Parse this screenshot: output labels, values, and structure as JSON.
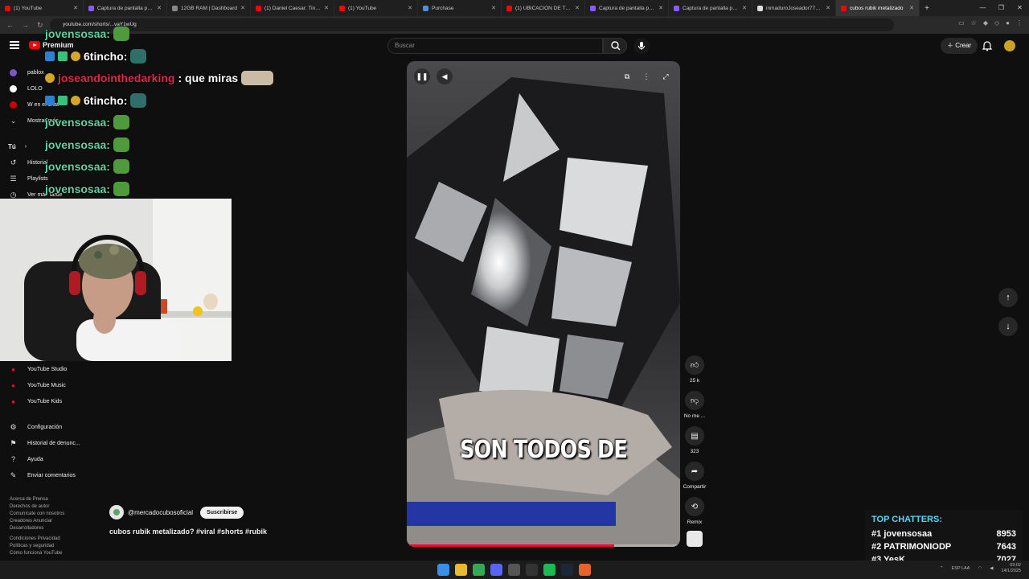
{
  "browser": {
    "tabs": [
      {
        "label": "(1) YouTube",
        "color": "#ff0000"
      },
      {
        "label": "Captura de pantalla por Lightshot",
        "color": "#8a5cf6"
      },
      {
        "label": "12GB RAM | Dashboard",
        "color": "#888888"
      },
      {
        "label": "(1) Daniel Caesar: Tiny Desk",
        "color": "#ff0000"
      },
      {
        "label": "(1) YouTube",
        "color": "#ff0000"
      },
      {
        "label": "Purchase",
        "color": "#4a90e2"
      },
      {
        "label": "(1) UBICACIÓN DE TODOS",
        "color": "#ff0000"
      },
      {
        "label": "Captura de pantalla por Lightshot",
        "color": "#8a5cf6"
      },
      {
        "label": "Captura de pantalla por Lightshot",
        "color": "#8a5cf6"
      },
      {
        "label": "inmaduroJoseador777 en X",
        "color": "#dddddd"
      },
      {
        "label": "cubos rubik metalizado",
        "color": "#ff0000"
      }
    ],
    "url": "youtube.com/shorts/...vaY1wUg"
  },
  "header": {
    "logo_text": "Premium",
    "search_placeholder": "Buscar",
    "create_label": "Crear"
  },
  "sidebar": {
    "top_items": [
      {
        "label": "pablox",
        "icon": "avatar-icon",
        "color": "#7a56c7"
      },
      {
        "label": "LOLO",
        "icon": "avatar-icon",
        "color": "#ffffff"
      },
      {
        "label": "W en el chat",
        "icon": "avatar-icon",
        "color": "#cc0000"
      },
      {
        "label": "Mostrar más",
        "icon": "chevron-down-icon"
      }
    ],
    "you_label": "Tú",
    "you_items": [
      {
        "label": "Historial",
        "icon": "history-icon"
      },
      {
        "label": "Playlists",
        "icon": "playlists-icon"
      },
      {
        "label": "Ver más tarde",
        "icon": "clock-icon"
      }
    ],
    "more_items": [
      {
        "label": "YouTube Studio"
      },
      {
        "label": "YouTube Music"
      },
      {
        "label": "YouTube Kids"
      }
    ],
    "settings_items": [
      {
        "label": "Configuración",
        "icon": "gear-icon"
      },
      {
        "label": "Historial de denunc...",
        "icon": "flag-icon"
      },
      {
        "label": "Ayuda",
        "icon": "help-icon"
      },
      {
        "label": "Enviar comentarios",
        "icon": "feedback-icon"
      }
    ],
    "footer": [
      "Acerca de  Prensa",
      "Derechos de autor",
      "Comunícate con nosotros",
      "Creadores  Anunciar",
      "Desarrolladores",
      "",
      "Condiciones  Privacidad",
      "Políticas y seguridad",
      "Cómo funciona YouTube"
    ]
  },
  "chat": [
    {
      "user": "jovensosaa:",
      "message": "",
      "color": "#5fd3a5"
    },
    {
      "user": "6tincho:",
      "message": "",
      "color": "#ffffff"
    },
    {
      "user": "joseandointhedarking",
      "message": ": que miras",
      "color": "#e0284d"
    },
    {
      "user": "6tincho:",
      "message": "",
      "color": "#ffffff"
    },
    {
      "user": "jovensosaa:",
      "message": "",
      "color": "#5fd3a5"
    },
    {
      "user": "jovensosaa:",
      "message": "",
      "color": "#5fd3a5"
    },
    {
      "user": "jovensosaa:",
      "message": "",
      "color": "#5fd3a5"
    },
    {
      "user": "jovensosaa:",
      "message": "",
      "color": "#5fd3a5"
    }
  ],
  "video": {
    "caption": "SON TODOS DE",
    "progress": 0.76,
    "channel": "@mercadocubosoficial",
    "subscribe_label": "Suscribirse",
    "title": "cubos rubik metalizado? #viral #shorts #rubik"
  },
  "actions": {
    "like_count": "25 k",
    "dislike_label": "No me ...",
    "comments_count": "323",
    "share_label": "Compartir",
    "remix_label": "Remix"
  },
  "top_chatters": {
    "title": "TOP CHATTERS:",
    "rows": [
      {
        "rank": "#1",
        "name": "jovensosaa",
        "count": "8953"
      },
      {
        "rank": "#2",
        "name": "PATRIMONIODP",
        "count": "7643"
      },
      {
        "rank": "#3",
        "name": "YesK",
        "count": "7027"
      }
    ]
  },
  "taskbar": {
    "lang": "ESP LAA",
    "time": "03:02",
    "date": "14/1/2025"
  }
}
